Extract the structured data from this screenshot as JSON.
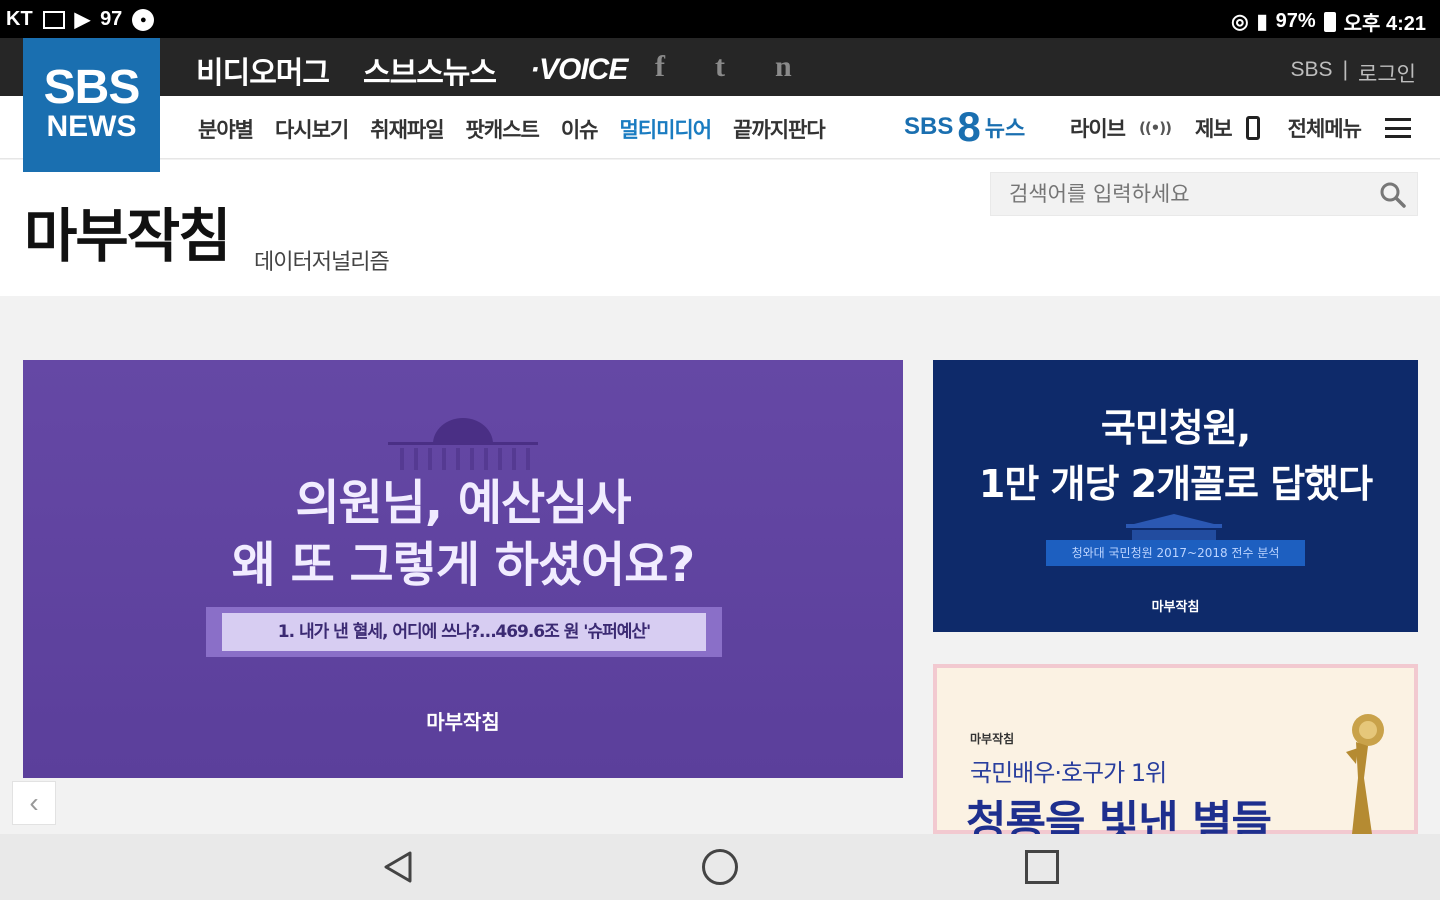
{
  "status_bar": {
    "carrier": "KT",
    "notification_count": "97",
    "battery": "97%",
    "time": "오후 4:21"
  },
  "logo": {
    "line1": "SBS",
    "line2": "NEWS"
  },
  "brands": [
    "비디오머그",
    "스브스뉴스",
    "·VOICE"
  ],
  "social": [
    "f",
    "t",
    "n"
  ],
  "top_links": {
    "sbs": "SBS",
    "separator": "|",
    "login": "로그인"
  },
  "categories": [
    "분야별",
    "다시보기",
    "취재파일",
    "팟캐스트",
    "이슈",
    "멀티미디어",
    "끝까지판다"
  ],
  "sbs8": {
    "prefix": "SBS",
    "num": "8",
    "suffix": "뉴스"
  },
  "right_menu": {
    "live": "라이브",
    "live_icon": "((•))",
    "report": "제보",
    "all_menu": "전체메뉴"
  },
  "search": {
    "placeholder": "검색어를 입력하세요"
  },
  "page": {
    "title": "마부작침",
    "subtitle": "데이터저널리즘"
  },
  "hero": {
    "line1": "의원님, 예산심사",
    "line2": "왜 또 그렇게 하셨어요?",
    "caption": "1. 내가 낸 혈세, 어디에 쓰나?…469.6조 원 '슈퍼예산'",
    "brand": "마부작침",
    "bg_color": "#5d419c"
  },
  "card1": {
    "line1": "국민청원,",
    "line2": "1만 개당 2개꼴로 답했다",
    "caption": "청와대 국민청원 2017~2018 전수 분석",
    "brand": "마부작침"
  },
  "card2": {
    "brand": "마부작침",
    "subtitle": "국민배우·호구가 1위",
    "title": "청룡을 빛낸 별들"
  },
  "carousel": {
    "prev": "‹"
  }
}
